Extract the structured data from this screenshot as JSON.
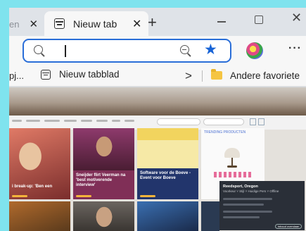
{
  "browser": {
    "prev_tab_title": "en",
    "active_tab_title": "Nieuw tab",
    "close_glyph": "✕",
    "new_tab_glyph": "+",
    "win_close_glyph": "✕",
    "more_glyph": "···"
  },
  "addressbar": {
    "value": "",
    "star_glyph": "★",
    "accent": "#1763d6"
  },
  "favorites": {
    "first_item": "pj...",
    "items": [
      {
        "label": "Nieuw tabblad",
        "icon": "tab-page-icon"
      }
    ],
    "overflow_glyph": ">",
    "other_label": "Andere favoriete"
  },
  "page": {
    "cards": [
      {
        "caption": "i break-up: 'Ben een"
      },
      {
        "caption": "Sneijder flirt Veerman na 'best motiverende interview'"
      },
      {
        "caption": "Software voor de Boeve - Event voor Boeve"
      },
      {
        "caption": ""
      }
    ],
    "shopping_tag": "TRENDING PRODUCTEN",
    "weather": {
      "title": "Reedsport, Oregon",
      "subtitle": "Voorkeur ˅ Stijl ˅ Huidige Pers ˅ Offline",
      "button": "Inhoud overslaan"
    },
    "colors": {
      "page_bg": "#e4e1dc",
      "frame_bg": "#7fe3ee"
    }
  }
}
